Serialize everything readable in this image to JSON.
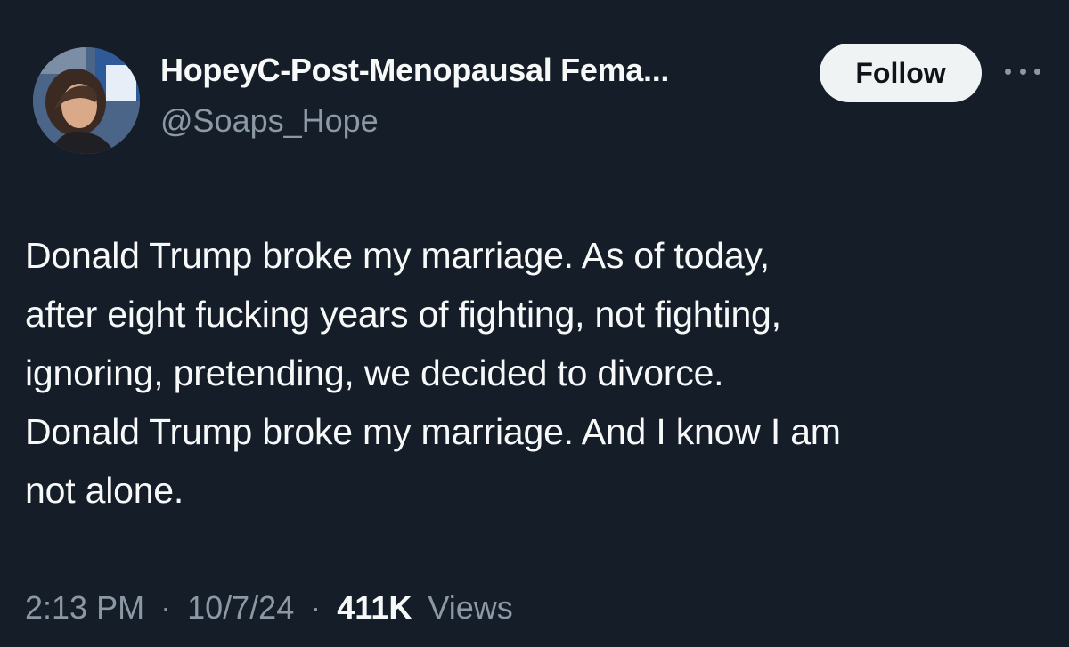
{
  "author": {
    "display_name": "HopeyC-Post-Menopausal Fema...",
    "handle": "@Soaps_Hope"
  },
  "follow_label": "Follow",
  "tweet": {
    "lines": [
      "Donald Trump broke my marriage. As of today,",
      "after eight fucking years of fighting, not fighting,",
      "ignoring, pretending, we decided to divorce.",
      "Donald Trump broke my marriage. And I know I am",
      "not alone."
    ]
  },
  "meta": {
    "time": "2:13 PM",
    "separator": "·",
    "date": "10/7/24",
    "views_count": "411K",
    "views_label": "Views"
  },
  "icons": {
    "more": "more-horizontal-icon"
  },
  "colors": {
    "background": "#151d28",
    "text": "#f7f9f9",
    "secondary": "#8b98a5",
    "follow_bg": "#eff3f4"
  }
}
